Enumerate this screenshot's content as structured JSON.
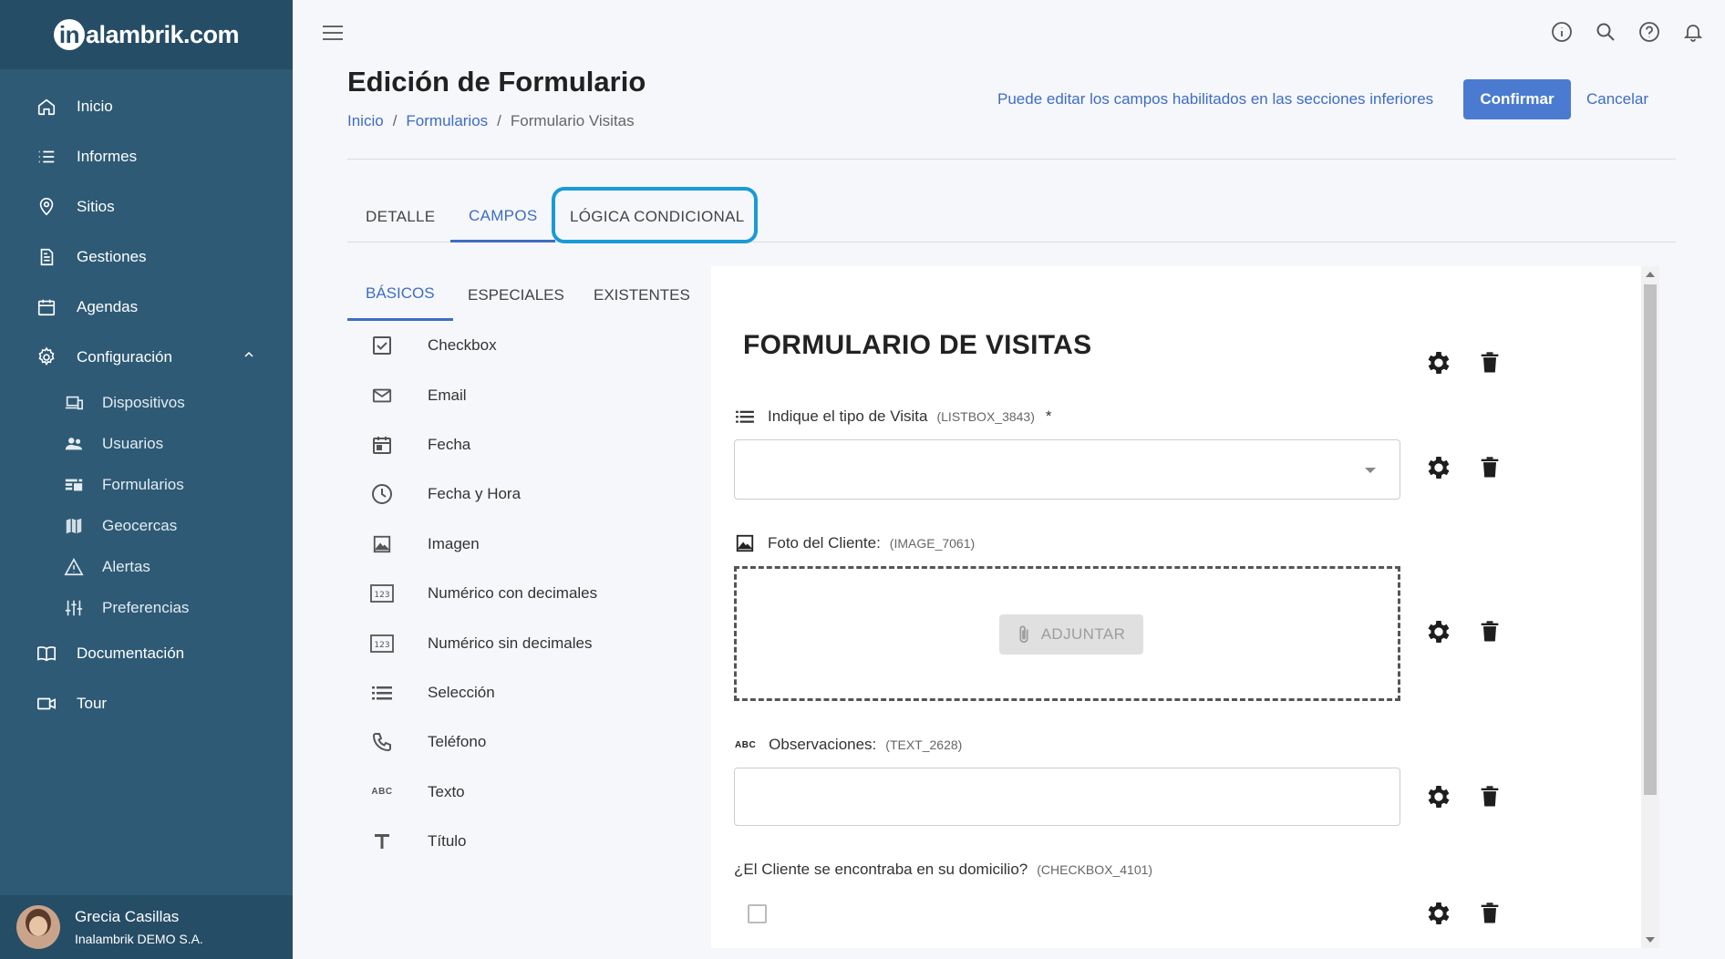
{
  "brand": {
    "logo_prefix": "in",
    "logo_text": "alambrik.com"
  },
  "sidebar": {
    "items": [
      {
        "label": "Inicio",
        "icon": "home-icon"
      },
      {
        "label": "Informes",
        "icon": "list-icon"
      },
      {
        "label": "Sitios",
        "icon": "location-pin-icon"
      },
      {
        "label": "Gestiones",
        "icon": "document-icon"
      },
      {
        "label": "Agendas",
        "icon": "calendar-icon"
      },
      {
        "label": "Configuración",
        "icon": "gear-icon",
        "expanded": true
      }
    ],
    "subitems": [
      {
        "label": "Dispositivos",
        "icon": "devices-icon"
      },
      {
        "label": "Usuarios",
        "icon": "people-icon"
      },
      {
        "label": "Formularios",
        "icon": "form-icon"
      },
      {
        "label": "Geocercas",
        "icon": "map-icon"
      },
      {
        "label": "Alertas",
        "icon": "warning-icon"
      },
      {
        "label": "Preferencias",
        "icon": "sliders-icon"
      }
    ],
    "bottom_items": [
      {
        "label": "Documentación",
        "icon": "book-icon"
      },
      {
        "label": "Tour",
        "icon": "video-icon"
      }
    ],
    "user": {
      "name": "Grecia Casillas",
      "org": "Inalambrik DEMO S.A."
    }
  },
  "header": {
    "title": "Edición de Formulario",
    "breadcrumb": [
      "Inicio",
      "Formularios",
      "Formulario Visitas"
    ],
    "hint": "Puede editar los campos habilitados en las secciones inferiores",
    "confirm_label": "Confirmar",
    "cancel_label": "Cancelar"
  },
  "tabs": [
    {
      "label": "DETALLE",
      "active": false
    },
    {
      "label": "CAMPOS",
      "active": true
    },
    {
      "label": "LÓGICA CONDICIONAL",
      "active": false,
      "highlighted": true
    }
  ],
  "subtabs": [
    {
      "label": "BÁSICOS",
      "active": true
    },
    {
      "label": "ESPECIALES",
      "active": false
    },
    {
      "label": "EXISTENTES",
      "active": false
    }
  ],
  "field_types": [
    {
      "label": "Checkbox",
      "icon": "checkbox-icon"
    },
    {
      "label": "Email",
      "icon": "email-icon"
    },
    {
      "label": "Fecha",
      "icon": "calendar-icon"
    },
    {
      "label": "Fecha y Hora",
      "icon": "clock-icon"
    },
    {
      "label": "Imagen",
      "icon": "image-icon"
    },
    {
      "label": "Numérico con decimales",
      "icon": "numeric-icon"
    },
    {
      "label": "Numérico sin decimales",
      "icon": "numeric-icon"
    },
    {
      "label": "Selección",
      "icon": "list-icon"
    },
    {
      "label": "Teléfono",
      "icon": "phone-icon"
    },
    {
      "label": "Texto",
      "icon": "text-abc-icon"
    },
    {
      "label": "Título",
      "icon": "title-icon"
    }
  ],
  "form": {
    "title": "FORMULARIO DE VISITAS",
    "fields": [
      {
        "label": "Indique el tipo de Visita",
        "code": "(LISTBOX_3843)",
        "required": "*",
        "type": "listbox"
      },
      {
        "label": "Foto del Cliente:",
        "code": "(IMAGE_7061)",
        "type": "image",
        "button": "ADJUNTAR"
      },
      {
        "label": "Observaciones:",
        "code": "(TEXT_2628)",
        "type": "text"
      },
      {
        "label": "¿El Cliente se encontraba en su domicilio?",
        "code": "(CHECKBOX_4101)",
        "type": "checkbox"
      }
    ]
  },
  "text_abc": "ABC",
  "numeric_glyph": "123",
  "colors": {
    "sidebar": "#2e5a75",
    "accent": "#3f6cc4",
    "confirm": "#4a7bd0",
    "highlight": "#1a9ad6"
  }
}
